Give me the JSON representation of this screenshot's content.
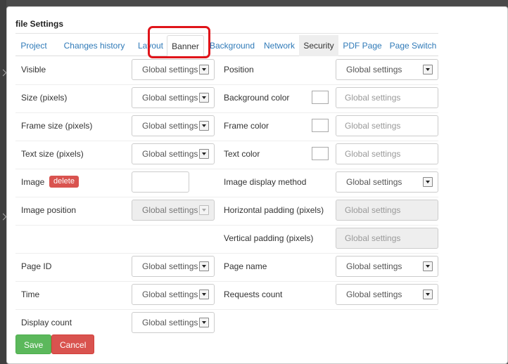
{
  "dialog": {
    "title": "file Settings"
  },
  "tabs": [
    {
      "label": "Project"
    },
    {
      "label": "Changes history"
    },
    {
      "label": "Layout"
    },
    {
      "label": "Banner"
    },
    {
      "label": "Background"
    },
    {
      "label": "Network"
    },
    {
      "label": "Security"
    },
    {
      "label": "PDF Page"
    },
    {
      "label": "Page Switch"
    }
  ],
  "active_tab": "Banner",
  "left_fields": {
    "visible": {
      "label": "Visible",
      "value": "Global settings"
    },
    "size": {
      "label": "Size (pixels)",
      "value": "Global settings"
    },
    "frame_size": {
      "label": "Frame size (pixels)",
      "value": "Global settings"
    },
    "text_size": {
      "label": "Text size (pixels)",
      "value": "Global settings"
    },
    "image": {
      "label": "Image",
      "delete_label": "delete",
      "value": ""
    },
    "image_position": {
      "label": "Image position",
      "value": "Global settings"
    },
    "page_id": {
      "label": "Page ID",
      "value": "Global settings"
    },
    "time": {
      "label": "Time",
      "value": "Global settings"
    },
    "display_count": {
      "label": "Display count",
      "value": "Global settings"
    }
  },
  "right_fields": {
    "position": {
      "label": "Position",
      "value": "Global settings"
    },
    "background_color": {
      "label": "Background color",
      "placeholder": "Global settings"
    },
    "frame_color": {
      "label": "Frame color",
      "placeholder": "Global settings"
    },
    "text_color": {
      "label": "Text color",
      "placeholder": "Global settings"
    },
    "image_display_method": {
      "label": "Image display method",
      "value": "Global settings"
    },
    "horizontal_padding": {
      "label": "Horizontal padding (pixels)",
      "placeholder": "Global settings"
    },
    "vertical_padding": {
      "label": "Vertical padding (pixels)",
      "placeholder": "Global settings"
    },
    "page_name": {
      "label": "Page name",
      "value": "Global settings"
    },
    "requests_count": {
      "label": "Requests count",
      "value": "Global settings"
    }
  },
  "footer": {
    "save_label": "Save",
    "cancel_label": "Cancel"
  },
  "colors": {
    "link": "#2f7ab8",
    "save": "#5cb85c",
    "cancel": "#d9534f",
    "highlight": "#e0141a"
  }
}
